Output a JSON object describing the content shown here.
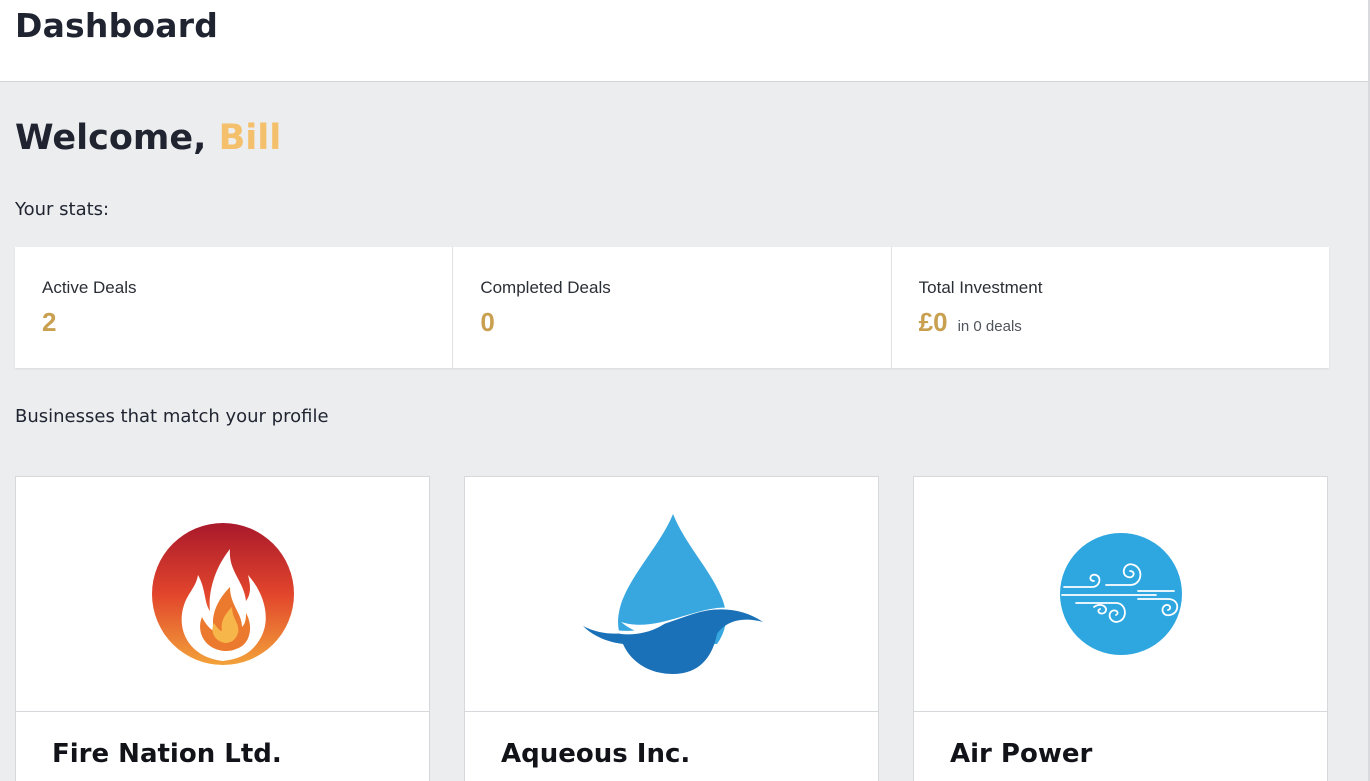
{
  "header": {
    "title": "Dashboard"
  },
  "welcome": {
    "greeting": "Welcome,",
    "name": "Bill"
  },
  "stats": {
    "label": "Your stats:",
    "items": [
      {
        "label": "Active Deals",
        "value": "2",
        "sub": ""
      },
      {
        "label": "Completed Deals",
        "value": "0",
        "sub": ""
      },
      {
        "label": "Total Investment",
        "value": "£0",
        "sub": "in 0 deals"
      }
    ]
  },
  "businesses": {
    "label": "Businesses that match your profile",
    "cards": [
      {
        "name": "Fire Nation Ltd.",
        "icon": "fire-logo-icon"
      },
      {
        "name": "Aqueous Inc.",
        "icon": "water-drop-logo-icon"
      },
      {
        "name": "Air Power",
        "icon": "wind-logo-icon"
      }
    ]
  },
  "colors": {
    "accent_name": "#f4c06b",
    "stat_value": "#c8a050",
    "background": "#ecedef",
    "fire_top": "#a9192b",
    "fire_bottom": "#f2a23a",
    "water_light": "#38a7df",
    "water_dark": "#1a71b8",
    "air": "#2ea6e0"
  }
}
